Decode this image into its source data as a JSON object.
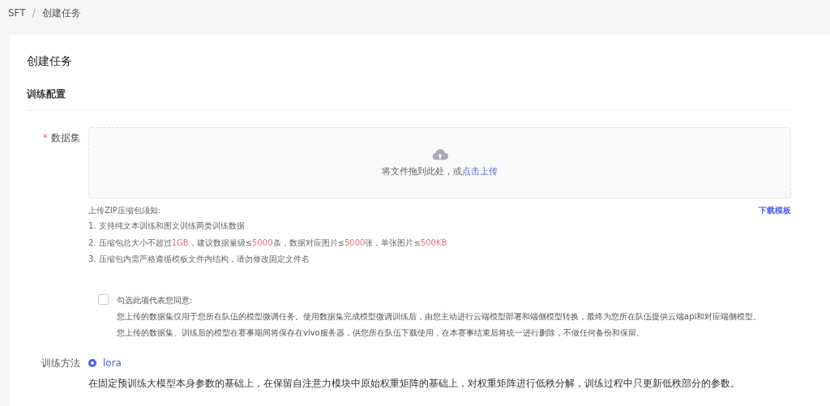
{
  "breadcrumb": [
    {
      "label": "SFT"
    },
    {
      "label": "创建任务"
    }
  ],
  "breadcrumb_separator": "/",
  "card": {
    "title": "创建任务",
    "section": "训练配置"
  },
  "dataset": {
    "label": "数据集",
    "required_mark": "*",
    "upload_hint": "将文件拖到此处，或",
    "upload_link": "点击上传",
    "download_link": "下载模板",
    "notes_title": "上传ZIP压缩包须知:",
    "notes": [
      [
        {
          "text": "1. 支持纯文本训练和图文训练两类训练数据",
          "highlight": false
        }
      ],
      [
        {
          "text": "2. 压缩包总大小不超过",
          "highlight": false
        },
        {
          "text": "1GB",
          "highlight": true
        },
        {
          "text": "，建议数据量级≤",
          "highlight": false
        },
        {
          "text": "5000",
          "highlight": true
        },
        {
          "text": "条，数据对应图片≤",
          "highlight": false
        },
        {
          "text": "5000",
          "highlight": true
        },
        {
          "text": "张，单张图片≤",
          "highlight": false
        },
        {
          "text": "500KB",
          "highlight": true
        }
      ],
      [
        {
          "text": "3. 压缩包内需严格遵循模板文件内结构，请勿修改固定文件名",
          "highlight": false
        }
      ]
    ]
  },
  "agreement": {
    "checked": false,
    "label": "勾选此项代表您同意:",
    "lines": [
      "您上传的数据集仅用于您所在队伍的模型微调任务。使用数据集完成模型微调训练后，由您主动进行云端模型部署和端侧模型转换，最终为您所在队伍提供云端api和对应端侧模型。",
      "您上传的数据集、训练后的模型在赛事期间将保存在vivo服务器，供您所在队伍下载使用，在本赛事结束后将统一进行删除，不做任何备份和保留。"
    ]
  },
  "method": {
    "label": "训练方法",
    "options": [
      {
        "label": "lora",
        "selected": true
      }
    ],
    "description": "在固定预训练大模型本身参数的基础上，在保留自注意力模块中原始权重矩阵的基础上，对权重矩阵进行低秩分解，训练过程中只更新低秩部分的参数。"
  }
}
